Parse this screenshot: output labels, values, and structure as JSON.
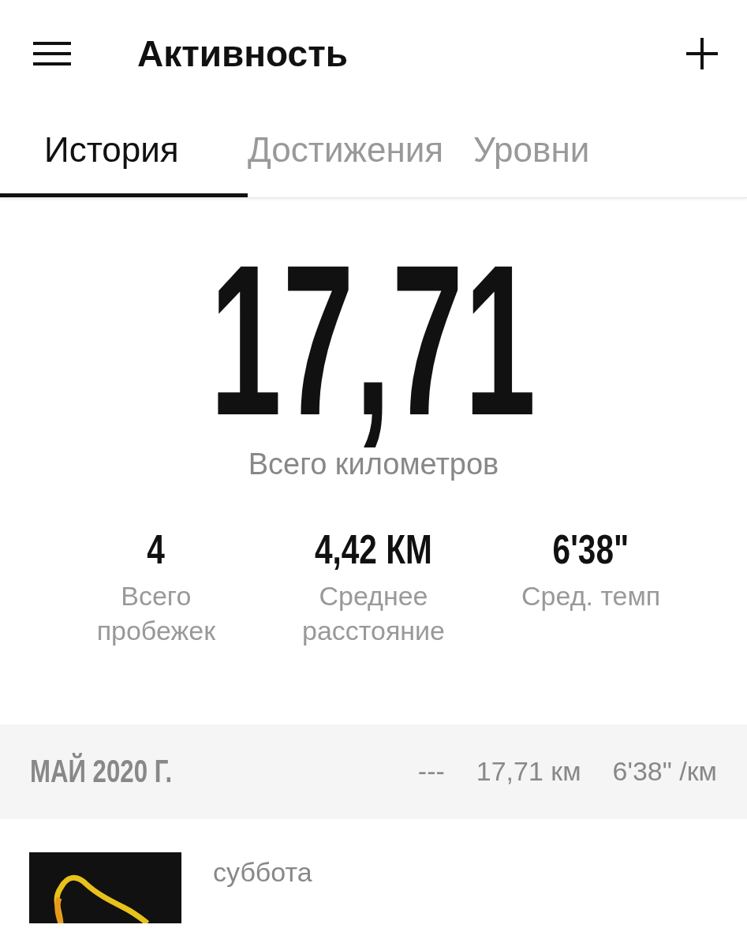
{
  "header": {
    "title": "Активность"
  },
  "tabs": [
    {
      "label": "История",
      "selected": true
    },
    {
      "label": "Достижения",
      "selected": false
    },
    {
      "label": "Уровни",
      "selected": false
    }
  ],
  "summary": {
    "total": "17,71",
    "total_label": "Всего километров"
  },
  "stats": [
    {
      "value": "4",
      "label": "Всего пробежек"
    },
    {
      "value": "4,42 КМ",
      "label": "Среднее расстояние"
    },
    {
      "value": "6'38\"",
      "label": "Сред. темп"
    }
  ],
  "month": {
    "title": "МАЙ 2020 Г.",
    "column_1": "---",
    "distance": "17,71 км",
    "pace": "6'38\" /км"
  },
  "runs": [
    {
      "day": "суббота",
      "kind": "picture"
    }
  ]
}
